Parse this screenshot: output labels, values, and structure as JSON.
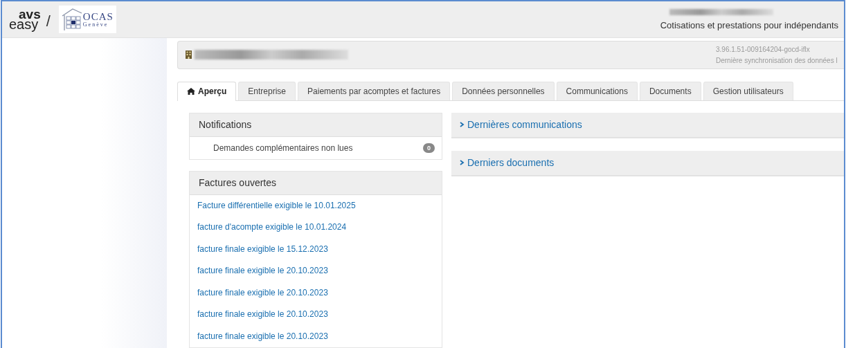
{
  "header": {
    "logo_top": "avs",
    "logo_bottom": "easy",
    "separator": "/",
    "ocas_name": "OCAS",
    "ocas_city": "Genève",
    "subtitle": "Cotisations et prestations pour indépendants"
  },
  "info_panel": {
    "version": "3.96.1.51-009164204-gocd-iflx",
    "sync": "Dernière synchronisation des données l"
  },
  "tabs": [
    {
      "label": "Aperçu",
      "selected": true
    },
    {
      "label": "Entreprise",
      "selected": false
    },
    {
      "label": "Paiements par acomptes et factures",
      "selected": false
    },
    {
      "label": "Données personnelles",
      "selected": false
    },
    {
      "label": "Communications",
      "selected": false
    },
    {
      "label": "Documents",
      "selected": false
    },
    {
      "label": "Gestion utilisateurs",
      "selected": false
    }
  ],
  "notifications": {
    "title": "Notifications",
    "items": [
      {
        "label": "Demandes complémentaires non lues",
        "count": "0"
      }
    ]
  },
  "open_invoices": {
    "title": "Factures ouvertes",
    "items": [
      "Facture différentielle exigible le 10.01.2025",
      "facture d'acompte exigible le 10.01.2024",
      "facture finale exigible le 15.12.2023",
      "facture finale exigible le 20.10.2023",
      "facture finale exigible le 20.10.2023",
      "facture finale exigible le 20.10.2023",
      "facture finale exigible le 20.10.2023"
    ]
  },
  "right_panels": [
    {
      "title": "Dernières communications",
      "expanded": false
    },
    {
      "title": "Derniers documents",
      "expanded": false
    }
  ]
}
